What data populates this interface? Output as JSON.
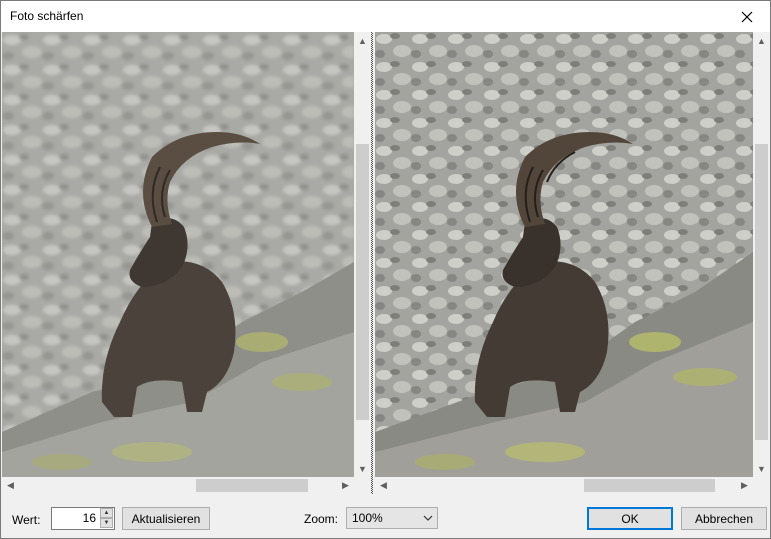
{
  "window": {
    "title": "Foto schärfen"
  },
  "footer": {
    "value_label": "Wert:",
    "value": "16",
    "update_button": "Aktualisieren",
    "zoom_label": "Zoom:",
    "zoom_value": "100%",
    "ok_button": "OK",
    "cancel_button": "Abbrechen"
  },
  "panes": {
    "left": {
      "content": "photo-original-ibex",
      "h_thumb_position": 0.5,
      "v_thumb_position": 0.5
    },
    "right": {
      "content": "photo-sharpened-ibex",
      "h_thumb_position": 0.5,
      "v_thumb_position": 0.5
    }
  },
  "colors": {
    "accent": "#0078d7",
    "scroll_thumb": "#cdcdcd",
    "button_face": "#e1e1e1"
  }
}
